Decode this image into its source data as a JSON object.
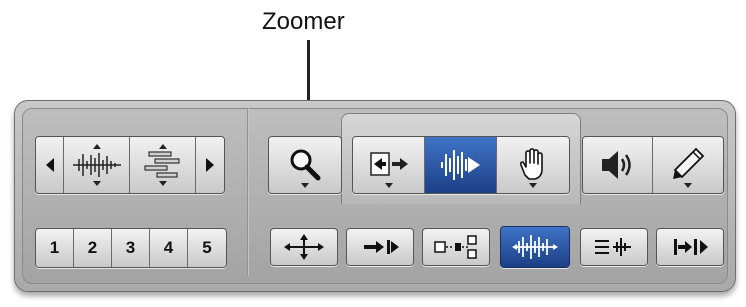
{
  "callout": {
    "label": "Zoomer"
  },
  "left": {
    "row1": {
      "icons": [
        "nudge-left-icon",
        "waveform-zoom-icon",
        "midi-zoom-icon",
        "nudge-right-icon"
      ]
    },
    "zoom_presets": [
      "1",
      "2",
      "3",
      "4",
      "5"
    ]
  },
  "right": {
    "row1_tools": [
      {
        "name": "zoomer-tool",
        "icon": "magnifier-icon",
        "active": false
      },
      {
        "name": "trim-tool",
        "icon": "trim-icon",
        "active": false
      },
      {
        "name": "selector-tool",
        "icon": "selector-waveform-icon",
        "active": true
      },
      {
        "name": "grabber-tool",
        "icon": "hand-icon",
        "active": false
      },
      {
        "name": "scrubber-tool",
        "icon": "speaker-icon",
        "active": false
      },
      {
        "name": "pencil-tool",
        "icon": "pencil-icon",
        "active": false
      }
    ],
    "row2_modes": [
      {
        "name": "shuffle-mode",
        "icon": "shuffle-arrows-icon",
        "active": false
      },
      {
        "name": "slip-mode",
        "icon": "slip-arrow-icon",
        "active": false
      },
      {
        "name": "spot-mode",
        "icon": "spot-icon",
        "active": false
      },
      {
        "name": "grid-mode",
        "icon": "grid-icon",
        "active": true
      },
      {
        "name": "edit-mode-a",
        "icon": "edit-lines-icon",
        "active": false
      },
      {
        "name": "edit-mode-b",
        "icon": "edit-arrow-icon",
        "active": false
      }
    ]
  },
  "colors": {
    "active_blue": "#2a55a8",
    "panel_gray": "#b4b4b4"
  }
}
